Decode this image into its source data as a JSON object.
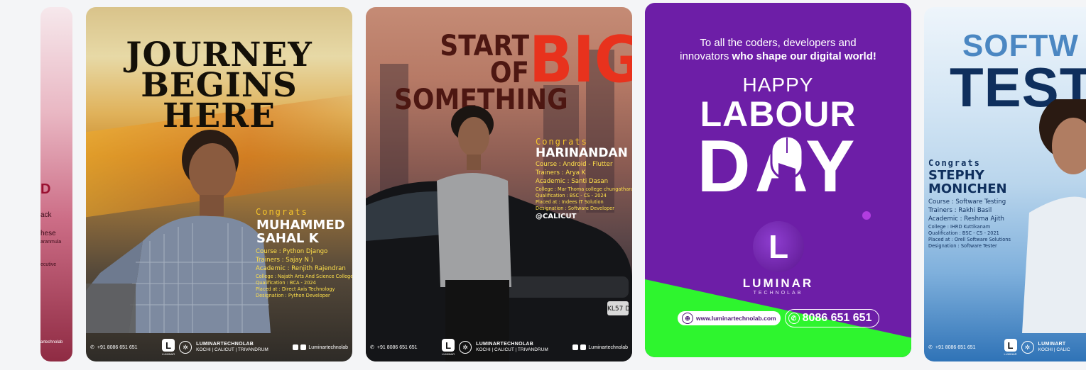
{
  "carousel": {
    "card0": {
      "lines": [
        "D",
        "ack",
        "hese",
        "aranmula",
        "ecutive",
        "artechnolab"
      ]
    },
    "card1": {
      "headline_line1": "JOURNEY",
      "headline_line2": "BEGINS HERE",
      "congrats": "Congrats",
      "name_line1": "MUHAMMED",
      "name_line2": "SAHAL K",
      "course": "Course : Python Django",
      "trainers": "Trainers : Sajay N )",
      "academic": "Academic : Renjith Rajendran",
      "college": "College : Najath Arts And Science College",
      "qualification": "Qualification : BCA - 2024",
      "placed": "Placed at : Direct Axis Technology",
      "designation": "Designation : Python Developer",
      "phone": "+91 8086 651 651",
      "brand": "LUMINARTECHNOLAB",
      "brand_sub": "KOCHI | CALICUT | TRIVANDRUM",
      "logo_caption": "LUMINAR",
      "social": "Luminartechnolab"
    },
    "card2": {
      "headline_line1": "START OF",
      "headline_line2": "SOMETHING",
      "headline_big": "BIG",
      "congrats": "Congrats",
      "name": "HARINANDAN",
      "course": "Course : Android - Flutter",
      "trainers": "Trainers : Arya K",
      "academic": "Academic : Santi Dasan",
      "college": "College : Mar Thoma college chungathara",
      "qualification": "Qualification : BSC - CS - 2024",
      "placed": "Placed at : Indees IT Solution",
      "designation": "Designation : Software Developer",
      "location": "@CALICUT",
      "phone": "+91 8086 651 651",
      "brand": "LUMINARTECHNOLAB",
      "brand_sub": "KOCHI | CALICUT | TRIVANDRUM",
      "logo_caption": "LUMINAR",
      "social": "Luminartechnolab",
      "plate": "KL57 D"
    },
    "card3": {
      "tagline_line1": "To all the coders, developers and",
      "tagline_line2_plain": "innovators ",
      "tagline_line2_bold": "who shape our digital world!",
      "happy": "HAPPY",
      "labour": "LABOUR",
      "day": "DAY",
      "logo_letter": "L",
      "brand": "LUMINAR",
      "brand_sub": "TECHNOLAB",
      "website": "www.luminartechnolab.com",
      "phone": "8086 651 651",
      "colors": {
        "bg": "#6d1ea7",
        "accent": "#2ef52e"
      }
    },
    "card4": {
      "headline_line1": "SOFTW",
      "headline_line2": "TEST",
      "congrats": "Congrats",
      "name_line1": "STEPHY",
      "name_line2": "MONICHEN",
      "course": "Course : Software Testing",
      "trainers": "Trainers : Rakhi Basil",
      "academic": "Academic : Reshma Ajith",
      "college": "College : IHRD Kuttikanam",
      "qualification": "Qualification : BSC - CS - 2021",
      "placed": "Placed at : Orell Software Solutions",
      "designation": "Designation : Software Tester",
      "phone": "+91 8086 651 651",
      "brand": "LUMINART",
      "brand_sub": "KOCHI | CALIC",
      "logo_caption": "LUMINAR"
    }
  }
}
